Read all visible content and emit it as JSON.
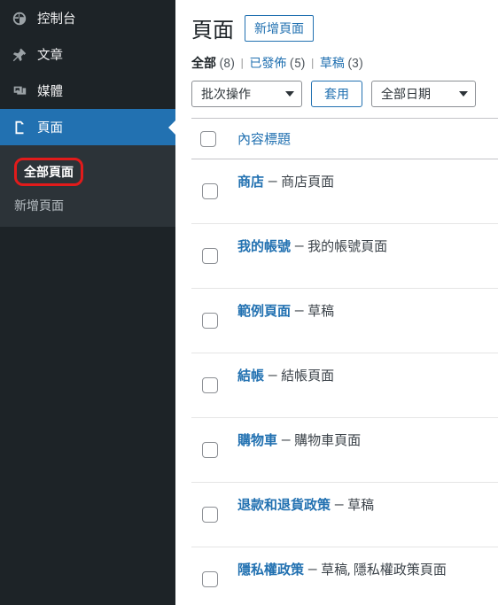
{
  "sidebar": {
    "items": [
      {
        "icon": "dashboard-icon",
        "label": "控制台"
      },
      {
        "icon": "pin-icon",
        "label": "文章"
      },
      {
        "icon": "media-icon",
        "label": "媒體"
      },
      {
        "icon": "page-icon",
        "label": "頁面",
        "open": true
      }
    ],
    "submenu": [
      {
        "label": "全部頁面",
        "current": true,
        "highlight": true
      },
      {
        "label": "新增頁面"
      }
    ]
  },
  "header": {
    "title": "頁面",
    "add_label": "新增頁面"
  },
  "filters": {
    "all_label": "全部",
    "all_count": "(8)",
    "published_label": "已發佈",
    "published_count": "(5)",
    "draft_label": "草稿",
    "draft_count": "(3)"
  },
  "actions": {
    "bulk_default": "批次操作",
    "apply_label": "套用",
    "date_default": "全部日期"
  },
  "table": {
    "title_header": "內容標題",
    "rows": [
      {
        "title": "商店",
        "suffix": " — 商店頁面"
      },
      {
        "title": "我的帳號",
        "suffix": " — 我的帳號頁面"
      },
      {
        "title": "範例頁面",
        "suffix": " — 草稿"
      },
      {
        "title": "結帳",
        "suffix": " — 結帳頁面"
      },
      {
        "title": "購物車",
        "suffix": " — 購物車頁面"
      },
      {
        "title": "退款和退貨政策",
        "suffix": " — 草稿"
      },
      {
        "title": "隱私權政策",
        "suffix": " — 草稿, 隱私權政策頁面"
      }
    ]
  }
}
